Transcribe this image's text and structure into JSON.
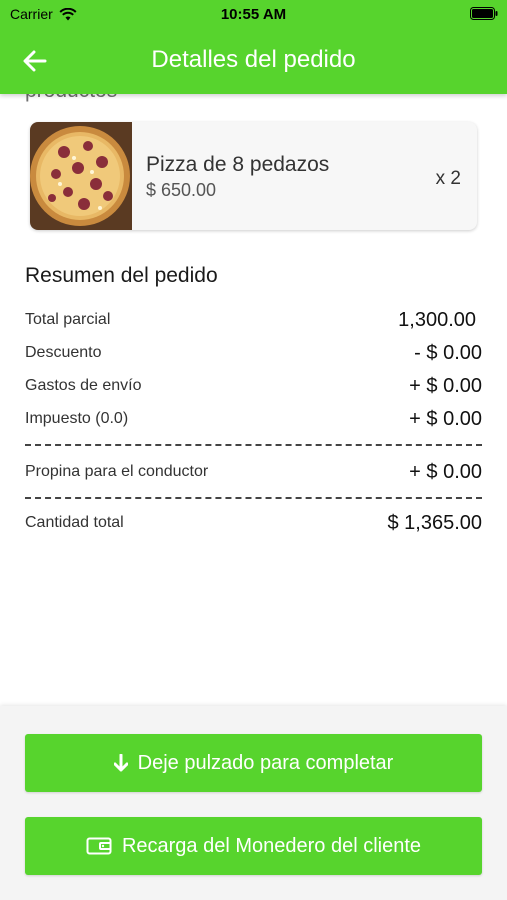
{
  "status_bar": {
    "carrier": "Carrier",
    "time": "10:55 AM"
  },
  "header": {
    "title": "Detalles del pedido"
  },
  "section": {
    "products_title": "productos"
  },
  "product": {
    "name": "Pizza de 8 pedazos",
    "price": "$ 650.00",
    "quantity": "x 2"
  },
  "summary": {
    "title": "Resumen del pedido",
    "subtotal": {
      "label": "Total parcial",
      "value": "1,300.00"
    },
    "discount": {
      "label": "Descuento",
      "value": "- $ 0.00"
    },
    "shipping": {
      "label": "Gastos de envío",
      "value": "+ $ 0.00"
    },
    "tax": {
      "label": "Impuesto (0.0)",
      "value": "+ $ 0.00"
    },
    "tip": {
      "label": "Propina para el conductor",
      "value": "+ $ 0.00"
    },
    "total": {
      "label": "Cantidad total",
      "value": "$ 1,365.00"
    }
  },
  "actions": {
    "complete_label": "Deje pulzado para completar",
    "recharge_label": "Recarga del Monedero del cliente"
  },
  "colors": {
    "accent": "#57d42d"
  }
}
